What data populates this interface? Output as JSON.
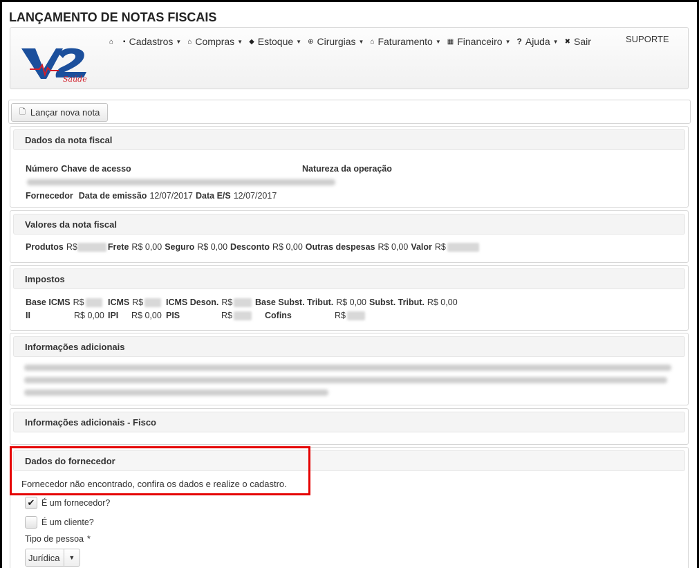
{
  "page": {
    "title": "LANÇAMENTO DE NOTAS FISCAIS"
  },
  "header": {
    "logo_alt": "V2 Saúde",
    "menu": [
      {
        "label": "Cadastros",
        "icon": "book-icon",
        "glyph": "▪",
        "has_caret": true
      },
      {
        "label": "Compras",
        "icon": "bank-icon",
        "glyph": "⌂",
        "has_caret": true
      },
      {
        "label": "Estoque",
        "icon": "tag-icon",
        "glyph": "◆",
        "has_caret": true
      },
      {
        "label": "Cirurgias",
        "icon": "plus-circle-icon",
        "glyph": "⊕",
        "has_caret": true
      },
      {
        "label": "Faturamento",
        "icon": "bank-icon",
        "glyph": "⌂",
        "has_caret": true
      },
      {
        "label": "Financeiro",
        "icon": "calculator-icon",
        "glyph": "▦",
        "has_caret": true
      },
      {
        "label": "Ajuda",
        "icon": "question-icon",
        "glyph": "?",
        "has_caret": true
      },
      {
        "label": "Sair",
        "icon": "close-circle-icon",
        "glyph": "✖",
        "has_caret": false
      }
    ],
    "home_icon": "home-icon",
    "suporte": "SUPORTE"
  },
  "actions": {
    "launch_button": "Lançar nova nota",
    "launch_icon": "file-icon"
  },
  "dados_nota": {
    "title": "Dados da nota fiscal",
    "numero_label": "Número",
    "chave_label": "Chave de acesso",
    "natureza_label": "Natureza da operação",
    "fornecedor_label": "Fornecedor",
    "data_emissao_label": "Data de emissão",
    "data_emissao": "12/07/2017",
    "data_es_label": "Data E/S",
    "data_es": "12/07/2017"
  },
  "valores": {
    "title": "Valores da nota fiscal",
    "produtos_label": "Produtos",
    "produtos_prefix": "R$",
    "frete_label": "Frete",
    "frete": "R$ 0,00",
    "seguro_label": "Seguro",
    "seguro": "R$ 0,00",
    "desconto_label": "Desconto",
    "desconto": "R$ 0,00",
    "outras_label": "Outras despesas",
    "outras": "R$ 0,00",
    "valor_label": "Valor",
    "valor_prefix": "R$"
  },
  "impostos": {
    "title": "Impostos",
    "base_icms_label": "Base ICMS",
    "base_icms_prefix": "R$",
    "icms_label": "ICMS",
    "icms_prefix": "R$",
    "icms_deson_label": "ICMS Deson.",
    "icms_deson_prefix": "R$",
    "base_subst_label": "Base Subst. Tribut.",
    "base_subst": "R$ 0,00",
    "subst_label": "Subst. Tribut.",
    "subst": "R$ 0,00",
    "ii_label": "II",
    "ii": "R$ 0,00",
    "ipi_label": "IPI",
    "ipi": "R$ 0,00",
    "pis_label": "PIS",
    "pis_prefix": "R$",
    "cofins_label": "Cofins",
    "cofins_prefix": "R$"
  },
  "info_adicionais": {
    "title": "Informações adicionais"
  },
  "info_fisco": {
    "title": "Informações adicionais - Fisco"
  },
  "fornecedor": {
    "title": "Dados do fornecedor",
    "message": "Fornecedor não encontrado, confira os dados e realize o cadastro.",
    "is_fornecedor_label": "É um fornecedor?",
    "is_fornecedor_checked": true,
    "is_cliente_label": "É um cliente?",
    "is_cliente_checked": false,
    "tipo_pessoa_label": "Tipo de pessoa",
    "required_mark": "*",
    "tipo_pessoa_value": "Jurídica"
  },
  "colors": {
    "highlight": "#e50000",
    "logo_blue": "#1b4f9c",
    "logo_red": "#d21f2b"
  }
}
